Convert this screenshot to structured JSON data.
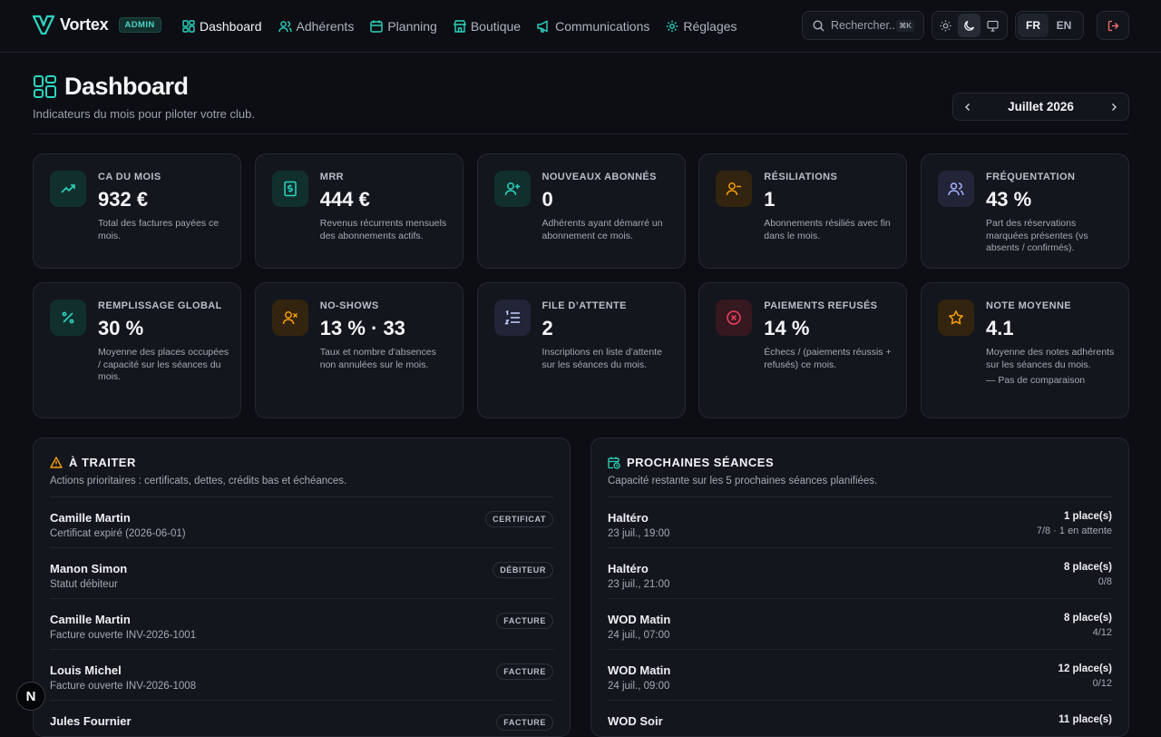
{
  "app": {
    "name": "Vortex",
    "badge": "ADMIN"
  },
  "nav": [
    {
      "label": "Dashboard",
      "icon": "dashboard-icon",
      "active": true
    },
    {
      "label": "Adhérents",
      "icon": "users-icon"
    },
    {
      "label": "Planning",
      "icon": "calendar-icon"
    },
    {
      "label": "Boutique",
      "icon": "store-icon"
    },
    {
      "label": "Communications",
      "icon": "megaphone-icon"
    },
    {
      "label": "Réglages",
      "icon": "gear-icon"
    }
  ],
  "search": {
    "placeholder": "Rechercher...",
    "shortcut": "⌘K"
  },
  "theme": {
    "options": [
      "light",
      "dark",
      "system"
    ],
    "selected": "dark"
  },
  "language": {
    "options": [
      "FR",
      "EN"
    ],
    "selected": "FR"
  },
  "header": {
    "title": "Dashboard",
    "subtitle": "Indicateurs du mois pour piloter votre club."
  },
  "month_selector": {
    "label": "Juillet 2026"
  },
  "kpis": [
    {
      "label": "CA DU MOIS",
      "value": "932 €",
      "desc": "Total des factures payées ce mois.",
      "icon": "trending-up-icon",
      "color": "#2dd4bf"
    },
    {
      "label": "MRR",
      "value": "444 €",
      "desc": "Revenus récurrents mensuels des abonnements actifs.",
      "icon": "receipt-icon",
      "color": "#2dd4bf"
    },
    {
      "label": "NOUVEAUX ABONNÉS",
      "value": "0",
      "desc": "Adhérents ayant démarré un abonnement ce mois.",
      "icon": "user-plus-icon",
      "color": "#2dd4bf"
    },
    {
      "label": "RÉSILIATIONS",
      "value": "1",
      "desc": "Abonnements résiliés avec fin dans le mois.",
      "icon": "user-minus-icon",
      "color": "#f59e0b"
    },
    {
      "label": "FRÉQUENTATION",
      "value": "43 %",
      "desc": "Part des réservations marquées présentes (vs absents / confirmés).",
      "icon": "users-icon",
      "color": "#a5b4fc"
    },
    {
      "label": "REMPLISSAGE GLOBAL",
      "value": "30 %",
      "desc": "Moyenne des places occupées / capacité sur les séances du mois.",
      "icon": "percent-icon",
      "color": "#2dd4bf"
    },
    {
      "label": "NO-SHOWS",
      "value": "13 % · 33",
      "desc": "Taux et nombre d'absences non annulées sur le mois.",
      "icon": "user-x-icon",
      "color": "#f59e0b"
    },
    {
      "label": "FILE D’ATTENTE",
      "value": "2",
      "desc": "Inscriptions en liste d’attente sur les séances du mois.",
      "icon": "list-ordered-icon",
      "color": "#c7d2fe"
    },
    {
      "label": "PAIEMENTS REFUSÉS",
      "value": "14 %",
      "desc": "Échecs / (paiements réussis + refusés) ce mois.",
      "icon": "x-circle-icon",
      "color": "#f43f5e"
    },
    {
      "label": "NOTE MOYENNE",
      "value": "4.1",
      "desc": "Moyenne des notes adhérents sur les séances du mois.",
      "compare": "— Pas de comparaison",
      "icon": "star-icon",
      "color": "#f59e0b"
    }
  ],
  "todo": {
    "title": "À TRAITER",
    "subtitle": "Actions prioritaires : certificats, dettes, crédits bas et échéances.",
    "items": [
      {
        "name": "Camille Martin",
        "detail": "Certificat expiré (2026-06-01)",
        "tag": "CERTIFICAT"
      },
      {
        "name": "Manon Simon",
        "detail": "Statut débiteur",
        "tag": "DÉBITEUR"
      },
      {
        "name": "Camille Martin",
        "detail": "Facture ouverte INV-2026-1001",
        "tag": "FACTURE"
      },
      {
        "name": "Louis Michel",
        "detail": "Facture ouverte INV-2026-1008",
        "tag": "FACTURE"
      },
      {
        "name": "Jules Fournier",
        "detail": "",
        "tag": "FACTURE"
      }
    ]
  },
  "sessions": {
    "title": "PROCHAINES SÉANCES",
    "subtitle": "Capacité restante sur les 5 prochaines séances planifiées.",
    "items": [
      {
        "name": "Haltéro",
        "date": "23 juil., 19:00",
        "places": "1 place(s)",
        "occupancy": "7/8 · 1 en attente"
      },
      {
        "name": "Haltéro",
        "date": "23 juil., 21:00",
        "places": "8 place(s)",
        "occupancy": "0/8"
      },
      {
        "name": "WOD Matin",
        "date": "24 juil., 07:00",
        "places": "8 place(s)",
        "occupancy": "4/12"
      },
      {
        "name": "WOD Matin",
        "date": "24 juil., 09:00",
        "places": "12 place(s)",
        "occupancy": "0/12"
      },
      {
        "name": "WOD Soir",
        "date": "",
        "places": "11 place(s)",
        "occupancy": ""
      }
    ]
  },
  "floating": {
    "label": "N"
  }
}
